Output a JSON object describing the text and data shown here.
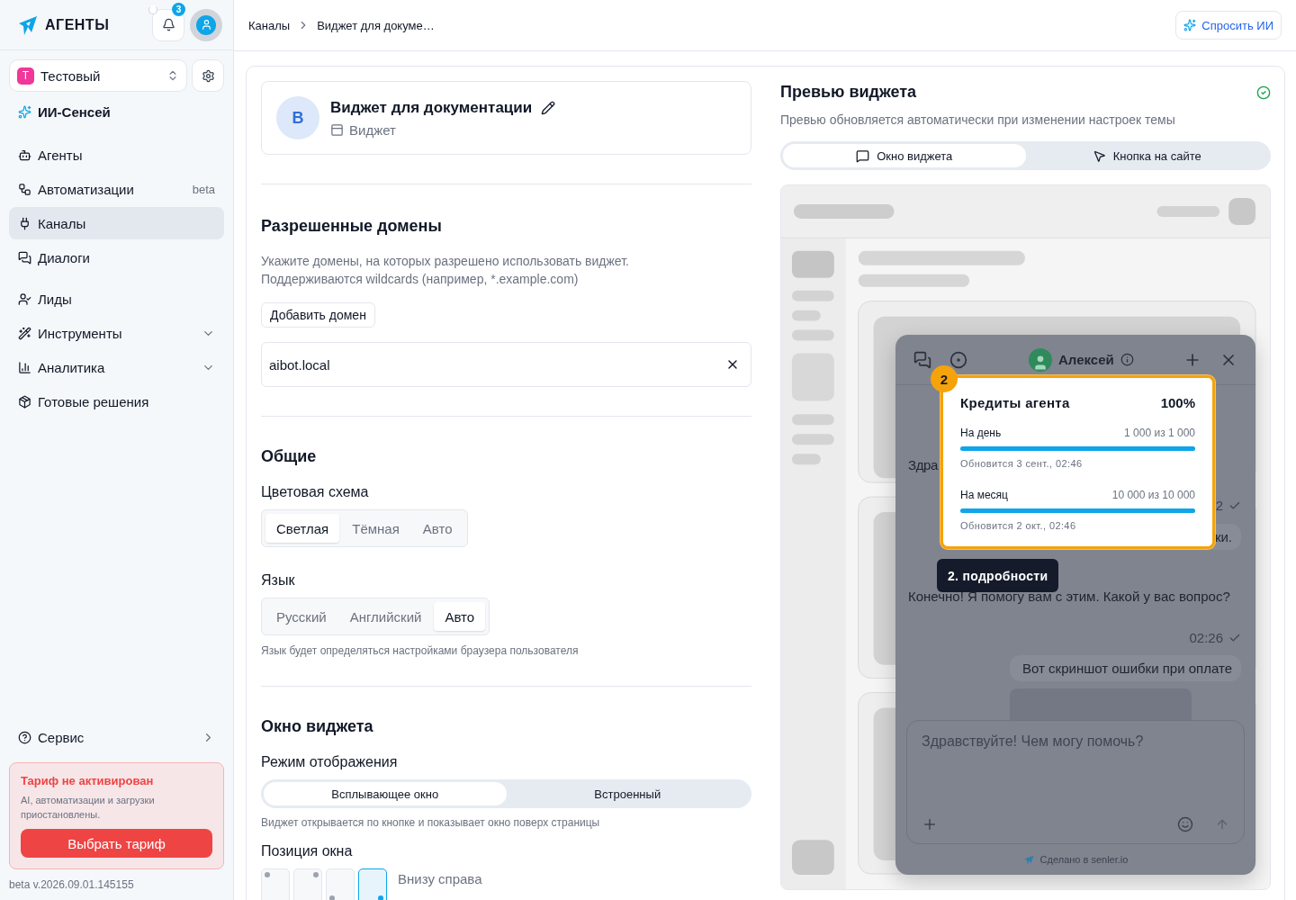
{
  "sidebar": {
    "logo": "АГЕНТЫ",
    "notification_count": "3",
    "workspace": {
      "initial": "Т",
      "name": "Тестовый"
    },
    "ai_item": "ИИ-Сенсей",
    "nav_sections": [
      [
        {
          "label": "Агенты",
          "kind": "link",
          "selected": false
        },
        {
          "label": "Автоматизации",
          "kind": "link",
          "badge": "beta",
          "selected": false
        },
        {
          "label": "Каналы",
          "kind": "link",
          "selected": true
        },
        {
          "label": "Диалоги",
          "kind": "link",
          "selected": false
        }
      ],
      [
        {
          "label": "Лиды",
          "kind": "link",
          "selected": false
        },
        {
          "label": "Инструменты",
          "kind": "group",
          "selected": false
        },
        {
          "label": "Аналитика",
          "kind": "group",
          "selected": false
        },
        {
          "label": "Готовые решения",
          "kind": "link",
          "selected": false
        }
      ]
    ],
    "service": "Сервис",
    "plan_alert": {
      "title": "Тариф не активирован",
      "text": "AI, автоматизации и загрузки приостановлены.",
      "button": "Выбрать тариф"
    },
    "version": "beta v.2026.09.01.145155"
  },
  "header": {
    "breadcrumbs": [
      "Каналы",
      "Виджет для докуме…"
    ],
    "ask_ai": "Спросить ИИ"
  },
  "widget_card": {
    "avatar": "В",
    "title": "Виджет для документации",
    "type": "Виджет"
  },
  "domains": {
    "title": "Разрешенные домены",
    "description": [
      "Укажите домены, на которых разрешено использовать виджет.",
      "Поддерживаются wildcards (например, *.example.com)"
    ],
    "add_button": "Добавить домен",
    "items": [
      "aibot.local"
    ]
  },
  "general": {
    "title": "Общие",
    "color_scheme": {
      "label": "Цветовая схема",
      "options": [
        {
          "label": "Светлая",
          "selected": true
        },
        {
          "label": "Тёмная",
          "selected": false
        },
        {
          "label": "Авто",
          "selected": false
        }
      ]
    },
    "language": {
      "label": "Язык",
      "options": [
        {
          "label": "Русский",
          "selected": false
        },
        {
          "label": "Английский",
          "selected": false
        },
        {
          "label": "Авто",
          "selected": true
        }
      ],
      "hint": "Язык будет определяться настройками браузера пользователя"
    }
  },
  "widget_window": {
    "title": "Окно виджета",
    "display_mode": {
      "label": "Режим отображения",
      "options": [
        {
          "label": "Всплывающее окно",
          "selected": true
        },
        {
          "label": "Встроенный",
          "selected": false
        }
      ],
      "hint": "Виджет открывается по кнопке и показывает окно поверх страницы"
    },
    "position": {
      "label": "Позиция окна",
      "options": [
        {
          "selected": false
        },
        {
          "selected": false
        },
        {
          "selected": false
        },
        {
          "selected": true
        }
      ],
      "value": "Внизу справа"
    }
  },
  "preview": {
    "title": "Превью виджета",
    "subtitle": "Превью обновляется автоматически при изменении настроек темы",
    "tabs": [
      {
        "label": "Окно виджета",
        "selected": true
      },
      {
        "label": "Кнопка на сайте",
        "selected": false
      }
    ],
    "chat": {
      "operator": "Алексей",
      "messages": [
        {
          "kind": "incoming",
          "text": "Здра"
        },
        {
          "kind": "time",
          "text": "2"
        },
        {
          "kind": "outgoing",
          "text": "ки."
        },
        {
          "kind": "incoming",
          "text": "Конечно! Я помогу вам с этим. Какой у вас вопрос?"
        },
        {
          "kind": "time",
          "text": "02:26"
        },
        {
          "kind": "outgoing",
          "text": "Вот скриншот ошибки при оплате"
        },
        {
          "kind": "attachment"
        }
      ],
      "input_placeholder": "Здравствуйте! Чем могу помочь?",
      "footer": "Сделано в senler.io"
    },
    "tour": {
      "step": "2",
      "tooltip": "2. подробности",
      "credits": {
        "title": "Кредиты агента",
        "total": "100%",
        "rows": [
          {
            "label": "На день",
            "value": "1 000 из 1 000",
            "level": 1,
            "renew": "Обновится 3 сент., 02:46"
          },
          {
            "label": "На месяц",
            "value": "10 000 из 10 000",
            "level": 1,
            "renew": "Обновится 2 окт., 02:46"
          }
        ]
      }
    }
  }
}
